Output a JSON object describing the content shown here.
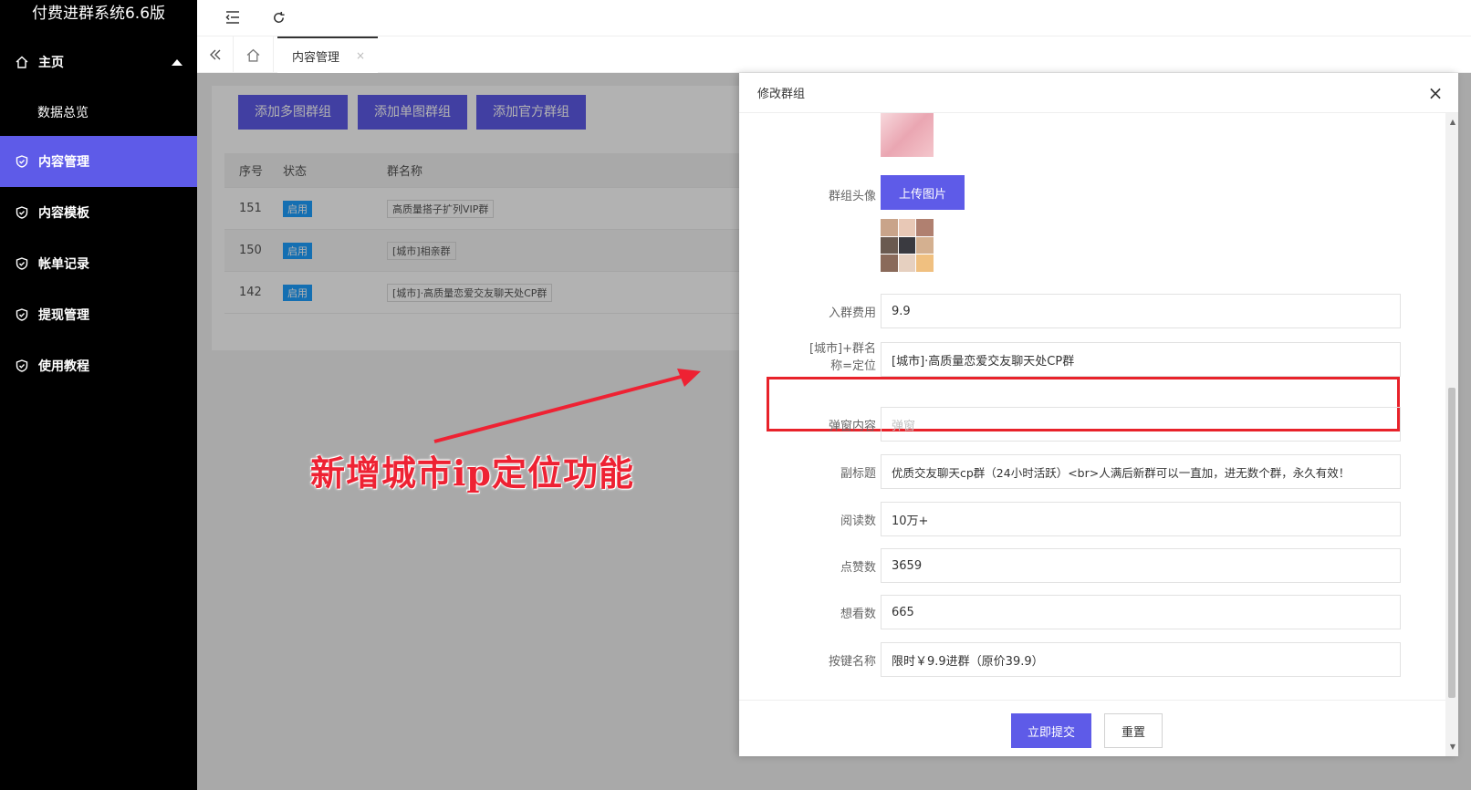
{
  "app": {
    "title": "付费进群系统6.6版"
  },
  "sidebar": {
    "items": [
      {
        "label": "主页"
      },
      {
        "label": "数据总览"
      },
      {
        "label": "内容管理"
      },
      {
        "label": "内容模板"
      },
      {
        "label": "帐单记录"
      },
      {
        "label": "提现管理"
      },
      {
        "label": "使用教程"
      }
    ]
  },
  "tabs": {
    "active_label": "内容管理",
    "close": "×"
  },
  "toolbar": {
    "add_multi": "添加多图群组",
    "add_single": "添加单图群组",
    "add_official": "添加官方群组"
  },
  "table": {
    "headers": [
      "序号",
      "状态",
      "群名称"
    ],
    "rows": [
      {
        "id": "151",
        "status": "启用",
        "name": "高质量搭子扩列VIP群"
      },
      {
        "id": "150",
        "status": "启用",
        "name": "[城市]相亲群"
      },
      {
        "id": "142",
        "status": "启用",
        "name": "[城市]·高质量恋爱交友聊天处CP群"
      }
    ]
  },
  "annotation": {
    "text": "新增城市ip定位功能"
  },
  "drawer": {
    "title": "修改群组",
    "close": "×",
    "avatar_label": "群组头像",
    "upload_label": "上传图片",
    "fee_label": "入群费用",
    "fee_value": "9.9",
    "name_label_1": "[城市]+群名",
    "name_label_2": "称=定位",
    "name_value": "[城市]·高质量恋爱交友聊天处CP群",
    "popup_label": "弹窗内容",
    "popup_placeholder": "弹窗",
    "subtitle_label": "副标题",
    "subtitle_value": "优质交友聊天cp群（24小时活跃）<br>人满后新群可以一直加，进无数个群，永久有效！",
    "reads_label": "阅读数",
    "reads_value": "10万+",
    "likes_label": "点赞数",
    "likes_value": "3659",
    "want_label": "想看数",
    "want_value": "665",
    "button_label": "按键名称",
    "button_value": "限时￥9.9进群（原价39.9）",
    "submit": "立即提交",
    "reset": "重置"
  },
  "colors": {
    "accent": "#5e5be8",
    "sidebar_bg": "#000000",
    "badge": "#1e9fff",
    "highlight": "#e8222a"
  }
}
